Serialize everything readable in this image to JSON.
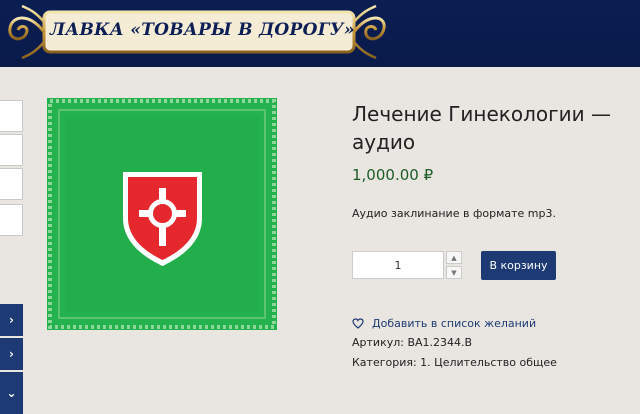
{
  "header": {
    "logo_text": "ЛАВКА «ТОВАРЫ В ДОРОГУ»",
    "background_color": "#0b1e52"
  },
  "sidebar": {
    "nav_items": [
      {
        "icon": "chevron-right-icon",
        "glyph": "›"
      },
      {
        "icon": "chevron-right-icon",
        "glyph": "›"
      },
      {
        "icon": "chevron-down-icon",
        "glyph": "⌄"
      }
    ]
  },
  "product": {
    "title": "Лечение Гинекологии — аудио",
    "price": "1,000.00 ₽",
    "description": "Аудио заклинание в формате mp3.",
    "quantity": "1",
    "add_to_cart_label": "В корзину",
    "wishlist_label": "Добавить в список желаний",
    "sku": "Артикул: BA1.2344.B",
    "category": "Категория: 1. Целительство общее",
    "image_icon": "red-shield-cross-icon",
    "image_background": "#23b24d",
    "accent_color": "#1d3a74"
  }
}
